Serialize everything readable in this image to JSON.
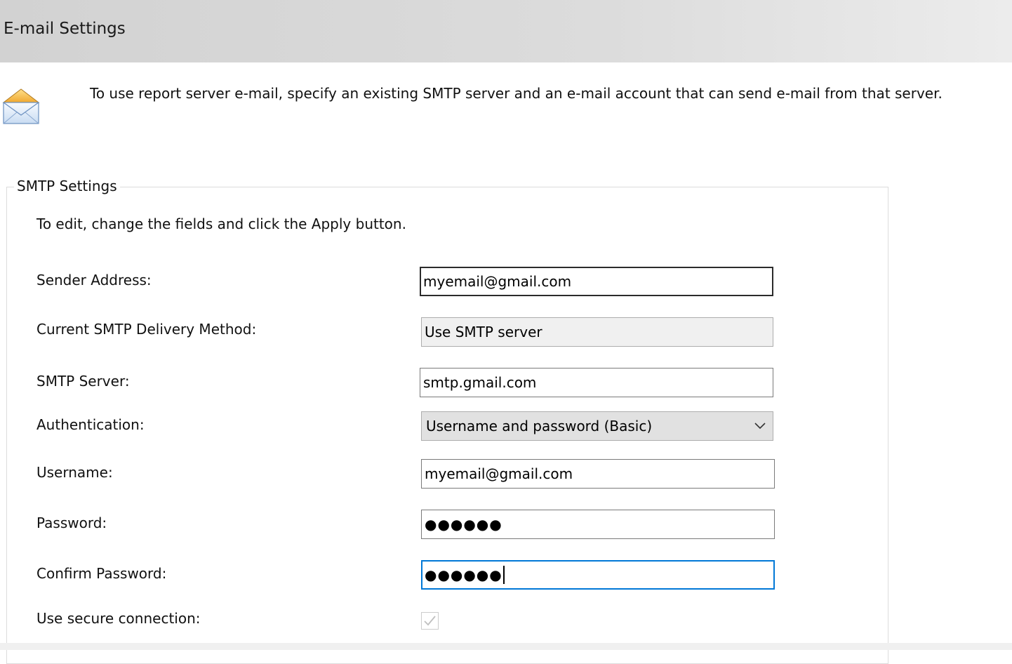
{
  "header": {
    "title": "E-mail Settings"
  },
  "intro": {
    "text": "To use report server e-mail, specify an existing SMTP server and an e-mail account that can send e-mail from that server."
  },
  "smtp_group": {
    "legend": "SMTP Settings",
    "instruction": "To edit, change the fields and click the Apply button.",
    "fields": {
      "sender_address": {
        "label": "Sender Address:",
        "value": "myemail@gmail.com"
      },
      "delivery_method": {
        "label": "Current SMTP Delivery Method:",
        "value": "Use SMTP server"
      },
      "smtp_server": {
        "label": "SMTP Server:",
        "value": "smtp.gmail.com"
      },
      "authentication": {
        "label": "Authentication:",
        "value": "Username and password (Basic)"
      },
      "username": {
        "label": "Username:",
        "value": "myemail@gmail.com"
      },
      "password": {
        "label": "Password:",
        "value": "●●●●●●"
      },
      "confirm_password": {
        "label": "Confirm Password:",
        "value": "●●●●●●"
      },
      "secure_connection": {
        "label": "Use secure connection:",
        "checked": true
      }
    }
  },
  "icons": {
    "mail": "envelope-icon",
    "dropdown": "chevron-down-icon",
    "check": "checkmark-icon"
  },
  "colors": {
    "focus_border": "#0078d7",
    "header_bg": "#d2d2d2"
  }
}
